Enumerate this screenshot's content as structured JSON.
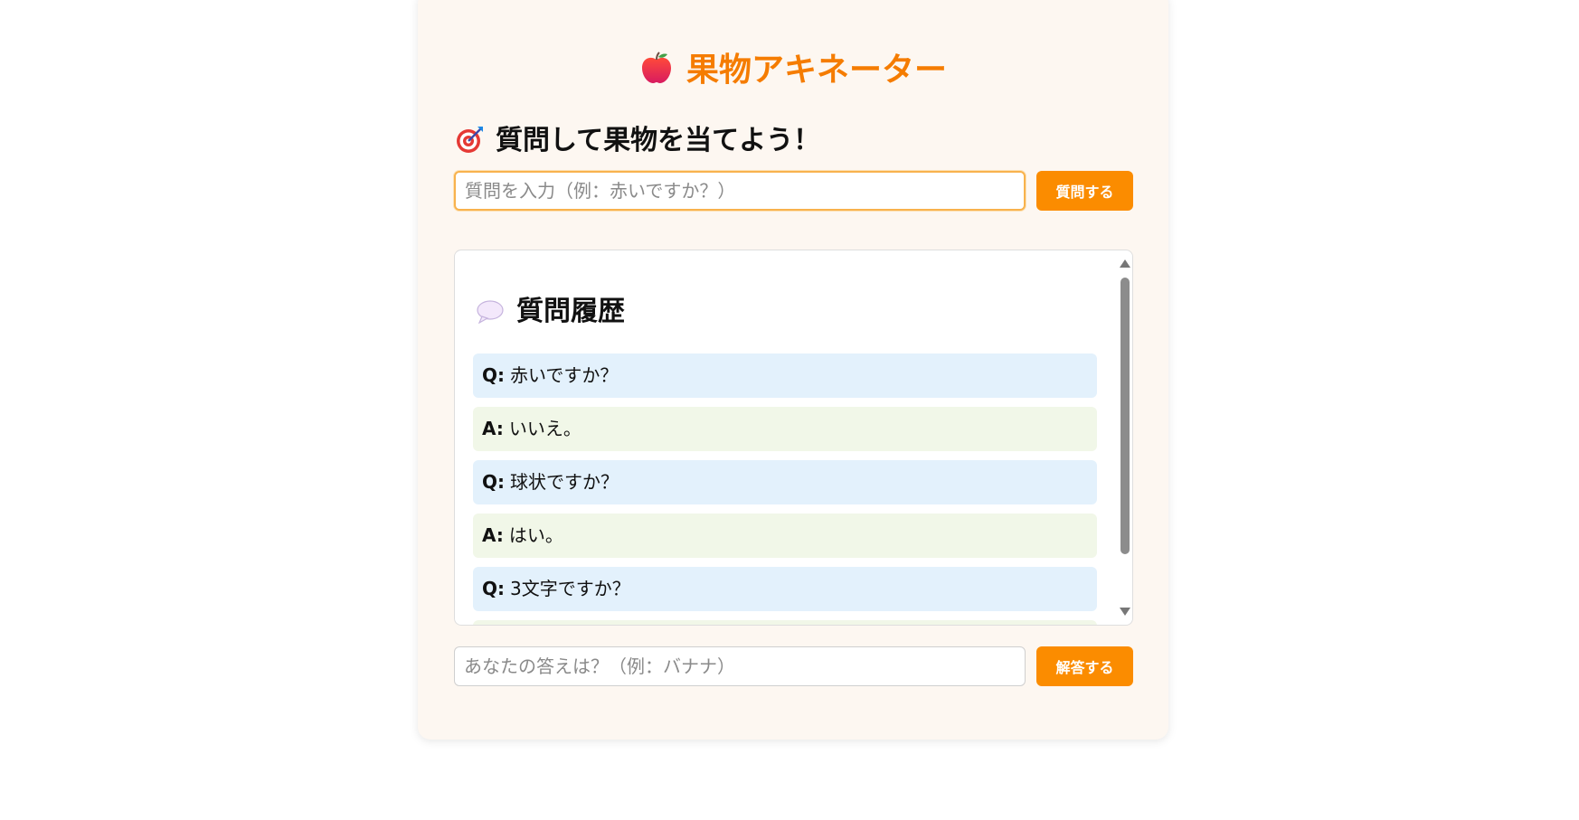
{
  "app": {
    "title": "果物アキネーター"
  },
  "question_section": {
    "heading": "質問して果物を当てよう！",
    "input_placeholder": "質問を入力（例：赤いですか？）",
    "input_value": "",
    "submit_label": "質問する"
  },
  "history": {
    "heading": "質問履歴",
    "items": [
      {
        "prefix": "Q:",
        "text": "赤いですか？",
        "kind": "question"
      },
      {
        "prefix": "A:",
        "text": "いいえ。",
        "kind": "answer"
      },
      {
        "prefix": "Q:",
        "text": "球状ですか？",
        "kind": "question"
      },
      {
        "prefix": "A:",
        "text": "はい。",
        "kind": "answer"
      },
      {
        "prefix": "Q:",
        "text": "3文字ですか？",
        "kind": "question"
      }
    ]
  },
  "answer_section": {
    "input_placeholder": "あなたの答えは？（例：バナナ）",
    "input_value": "",
    "submit_label": "解答する"
  },
  "icons": {
    "title_icon": "apple-icon",
    "question_icon": "target-icon",
    "history_icon": "speech-bubble-icon"
  },
  "colors": {
    "accent": "#fb8c00",
    "title": "#f57c00",
    "question_bg": "#e3f1fc",
    "answer_bg": "#f1f7e8",
    "card_bg": "#fdf7f1"
  }
}
